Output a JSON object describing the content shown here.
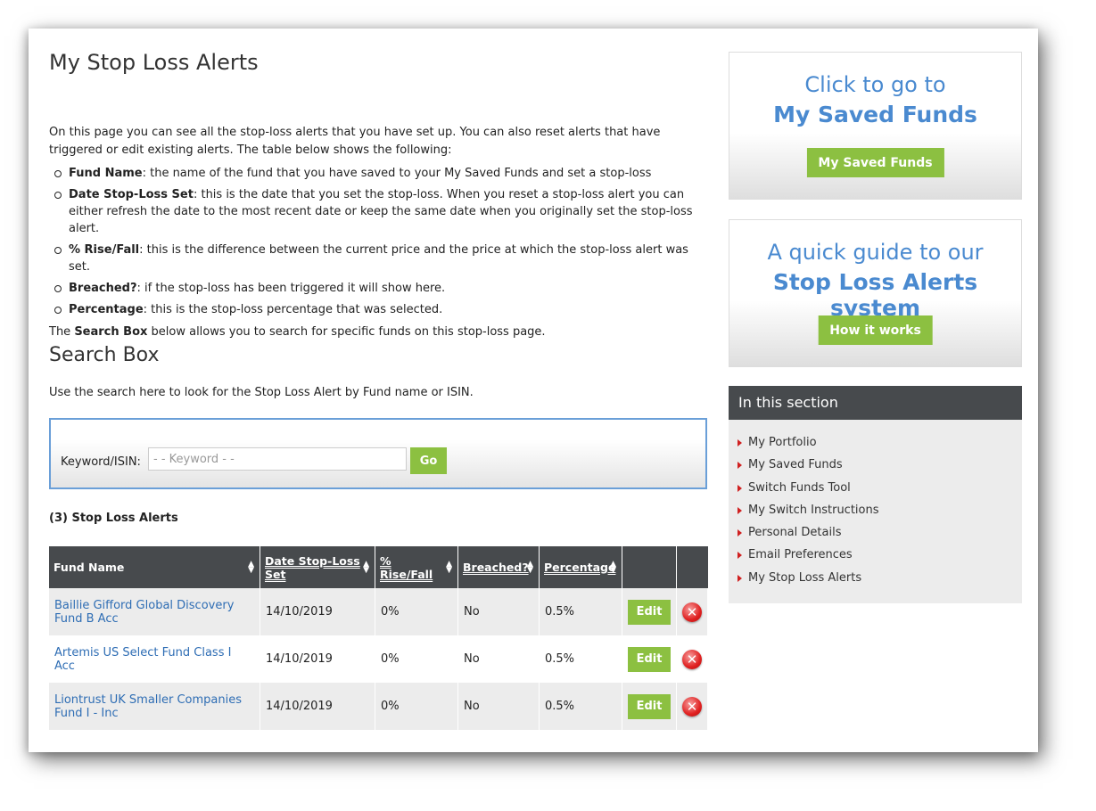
{
  "page": {
    "title": "My Stop Loss Alerts",
    "intro_text": "On this page you can see all the stop-loss alerts that you have set up. You can also reset alerts that have triggered or edit existing alerts. The table below shows the following:",
    "bullets": [
      {
        "term": "Fund Name",
        "desc": ": the name of the fund that you have saved to your My Saved Funds and set a stop-loss"
      },
      {
        "term": "Date Stop-Loss Set",
        "desc": ": this is the date that you set the stop-loss. When you reset a stop-loss alert you can either refresh the date to the most recent date or keep the same date when you originally set the stop-loss alert."
      },
      {
        "term": "% Rise/Fall",
        "desc": ": this is the difference between the current price and the price at which the stop-loss alert was set."
      },
      {
        "term": "Breached?",
        "desc": ": if the stop-loss has been triggered it will show here."
      },
      {
        "term": "Percentage",
        "desc": ": this is the stop-loss percentage that was selected."
      }
    ],
    "search_note_pre": "The ",
    "search_note_bold": "Search Box",
    "search_note_post": " below allows you to search for specific funds on this stop-loss page."
  },
  "search": {
    "title": "Search Box",
    "description": "Use the search here to look for the Stop Loss Alert by Fund name or ISIN.",
    "label": "Keyword/ISIN:",
    "placeholder": "- - Keyword - -",
    "value": "",
    "go_label": "Go"
  },
  "alerts": {
    "count_title": "(3) Stop Loss Alerts",
    "columns": {
      "fund_name": "Fund Name",
      "date_l1": "Date Stop-Loss",
      "date_l2": "Set",
      "rise_l1": "%",
      "rise_l2": "Rise/Fall",
      "breached": "Breached?",
      "percentage": "Percentage"
    },
    "edit_label": "Edit",
    "rows": [
      {
        "fund": "Baillie Gifford Global Discovery Fund B Acc",
        "date": "14/10/2019",
        "rise": "0%",
        "breached": "No",
        "pct": "0.5%"
      },
      {
        "fund": "Artemis US Select Fund Class I Acc",
        "date": "14/10/2019",
        "rise": "0%",
        "breached": "No",
        "pct": "0.5%"
      },
      {
        "fund": "Liontrust UK Smaller Companies Fund I - Inc",
        "date": "14/10/2019",
        "rise": "0%",
        "breached": "No",
        "pct": "0.5%"
      }
    ]
  },
  "sidebar": {
    "promo1": {
      "line1": "Click to go to",
      "line2": "My Saved Funds",
      "button": "My Saved Funds"
    },
    "promo2": {
      "line1": "A quick guide to our",
      "line2": "Stop Loss Alerts system",
      "button": "How it works"
    },
    "section": {
      "title": "In this section",
      "items": [
        "My Portfolio",
        "My Saved Funds",
        "Switch Funds Tool",
        "My Switch Instructions",
        "Personal Details",
        "Email Preferences",
        "My Stop Loss Alerts"
      ]
    }
  },
  "colors": {
    "accent_green": "#8cc041",
    "link_blue": "#2e6db4",
    "header_dark": "#474a4d",
    "delete_red": "#e02020"
  },
  "icons": {
    "sort": "sort-arrows-icon",
    "delete": "delete-circle-x-icon",
    "bullet": "red-triangle-bullet-icon"
  }
}
